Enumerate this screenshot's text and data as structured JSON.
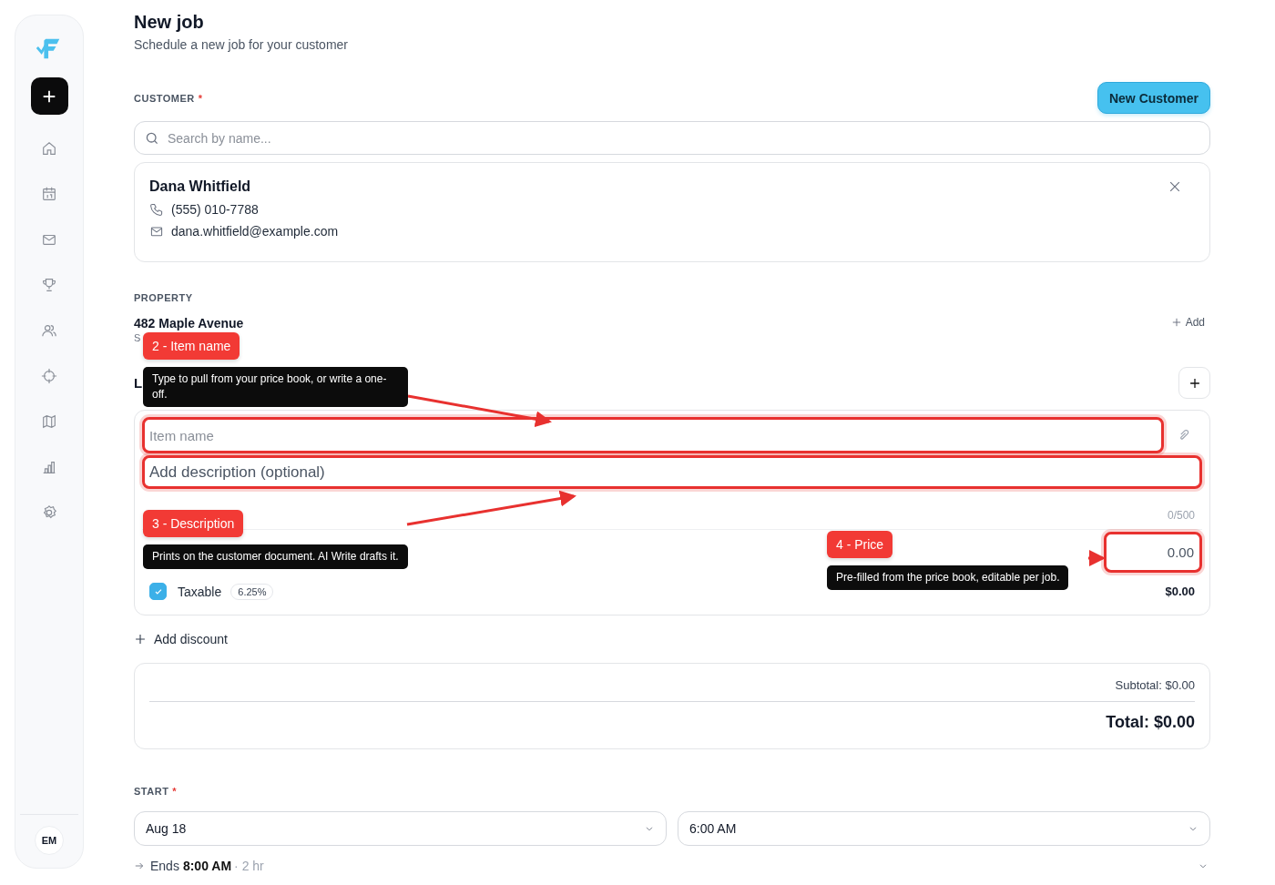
{
  "sidebar": {
    "avatar": "EM"
  },
  "header": {
    "title": "New job",
    "subtitle": "Schedule a new job for your customer"
  },
  "customer": {
    "label": "CUSTOMER",
    "required_mark": "*",
    "new_button": "New Customer",
    "search": {
      "placeholder": "Search by name..."
    },
    "card": {
      "name": "Dana Whitfield",
      "phone": "(555) 010-7788",
      "email": "dana.whitfield@example.com"
    }
  },
  "property": {
    "label": "PROPERTY",
    "address": "482 Maple Avenue",
    "detail": "S",
    "add_button": "Add"
  },
  "line_items": {
    "heading": "L",
    "item": {
      "name": {
        "placeholder": "Item name",
        "highlighted": true
      },
      "description": {
        "placeholder": "Add description (optional)",
        "highlighted": true
      },
      "counter": "0/500",
      "price": {
        "value": "0.00",
        "highlighted": true
      },
      "taxable": {
        "label": "Taxable",
        "checked": true,
        "rate": "6.25%"
      },
      "amount": "$0.00"
    }
  },
  "add_discount": "Add discount",
  "summary": {
    "subtotal": "Subtotal: $0.00",
    "total": "Total: $0.00"
  },
  "start": {
    "label": "START",
    "required_mark": "*",
    "date": "Aug 18",
    "time": "6:00 AM",
    "ends": {
      "prefix": "Ends",
      "time": "8:00 AM",
      "duration": "· 2 hr"
    }
  },
  "annotations": [
    {
      "badge": "2 - Item name",
      "note": "Type to pull from your price book, or write a one-off."
    },
    {
      "badge": "3 - Description",
      "note": "Prints on the customer document. AI Write drafts it."
    },
    {
      "badge": "4 - Price",
      "note": "Pre-filled from the price book, editable per job."
    }
  ]
}
